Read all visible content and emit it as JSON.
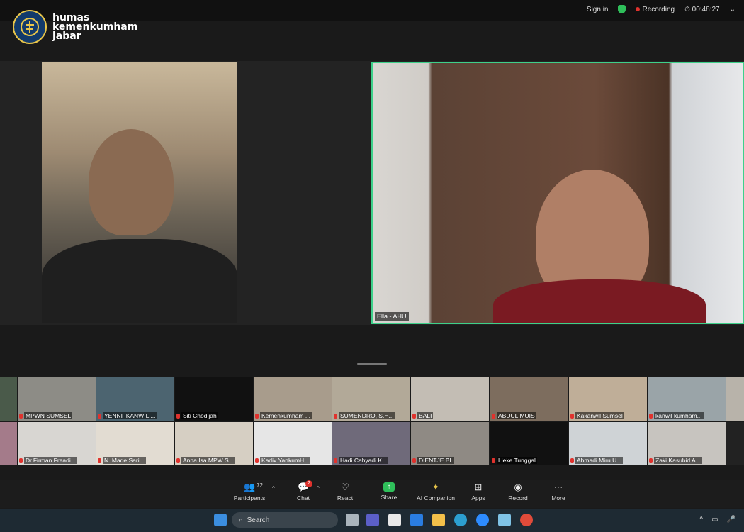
{
  "watermark": {
    "line1": "humas",
    "line2": "kemenkumham",
    "line3": "jabar"
  },
  "topbar": {
    "sign_in": "Sign in",
    "recording": "Recording",
    "timer": "00:48:27"
  },
  "speakers": [
    {
      "name": ""
    },
    {
      "name": "Ella - AHU"
    }
  ],
  "gallery": [
    {
      "name": "MPWN SUMSEL"
    },
    {
      "name": "YENNI_KANWIL ..."
    },
    {
      "name": "Siti Chodijah"
    },
    {
      "name": "Kemenkumham ..."
    },
    {
      "name": "SUMENDRO, S.H..."
    },
    {
      "name": "BALI"
    },
    {
      "name": "ABDUL MUIS"
    },
    {
      "name": "Kakanwil Sumsel"
    },
    {
      "name": "kanwil kumham..."
    },
    {
      "name": "Dr.Firman Freadi..."
    },
    {
      "name": "N. Made Sari..."
    },
    {
      "name": "Anna Isa MPW S..."
    },
    {
      "name": "Kadiv YankumH..."
    },
    {
      "name": "Hadi Cahyadi K..."
    },
    {
      "name": "DIENTJE BL"
    },
    {
      "name": "Lieke Tunggal"
    },
    {
      "name": "Ahmadi Miru U..."
    },
    {
      "name": "Zaki Kasubid A..."
    }
  ],
  "toolbar": {
    "participants_label": "Participants",
    "participants_count": "72",
    "chat_label": "Chat",
    "chat_badge": "2",
    "react_label": "React",
    "share_label": "Share",
    "ai_label": "AI Companion",
    "apps_label": "Apps",
    "record_label": "Record",
    "more_label": "More"
  },
  "taskbar": {
    "search_placeholder": "Search"
  },
  "colors": {
    "active_speaker_border": "#3ed08a",
    "share_green": "#2fbf5a",
    "recording_red": "#e0322d"
  }
}
